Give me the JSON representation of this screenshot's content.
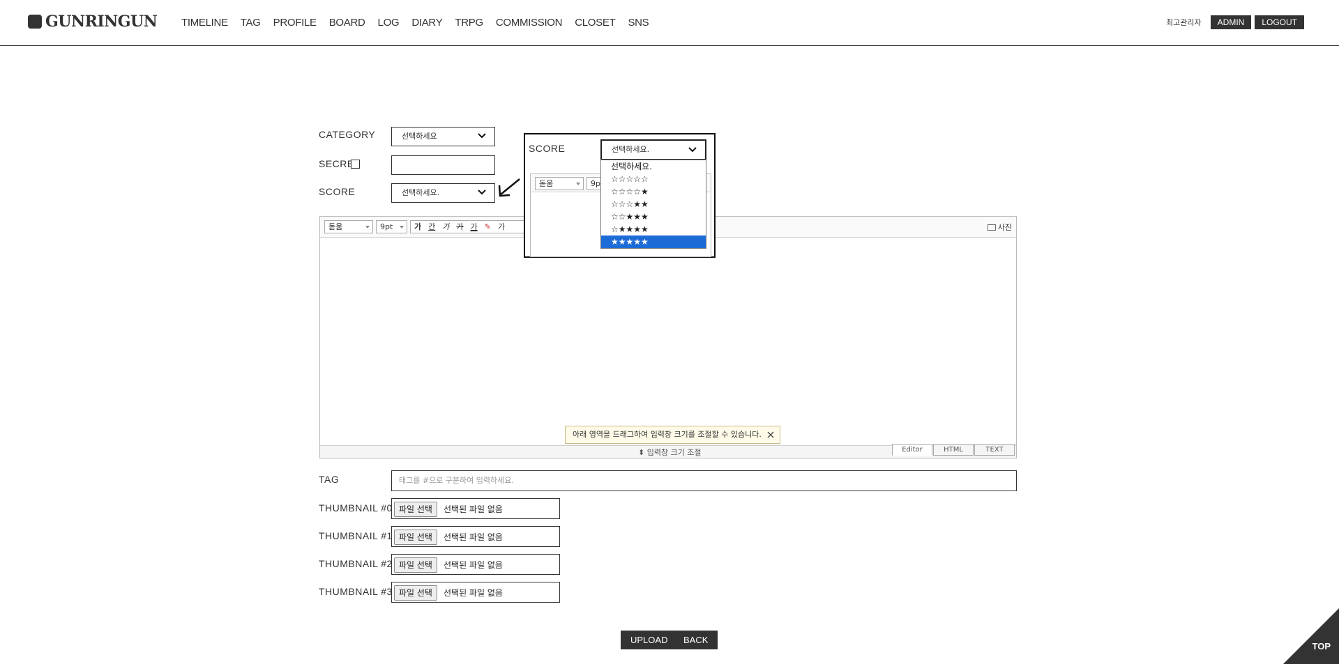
{
  "header": {
    "logo": "GUNRINGUN",
    "nav": [
      "TIMELINE",
      "TAG",
      "PROFILE",
      "BOARD",
      "LOG",
      "DIARY",
      "TRPG",
      "COMMISSION",
      "CLOSET",
      "SNS"
    ],
    "user_name": "최고관리자",
    "admin_label": "ADMIN",
    "logout_label": "LOGOUT"
  },
  "form": {
    "category_label": "CATEGORY",
    "category_value": "선택하세요",
    "secret_label": "SECRET",
    "score_label": "SCORE",
    "score_value": "선택하세요.",
    "tag_label": "TAG",
    "tag_placeholder": "태그를 #으로 구분하여 입력하세요.",
    "thumbnails": [
      {
        "label": "THUMBNAIL #0",
        "button": "파일 선택",
        "status": "선택된 파일 없음"
      },
      {
        "label": "THUMBNAIL #1",
        "button": "파일 선택",
        "status": "선택된 파일 없음"
      },
      {
        "label": "THUMBNAIL #2",
        "button": "파일 선택",
        "status": "선택된 파일 없음"
      },
      {
        "label": "THUMBNAIL #3",
        "button": "파일 선택",
        "status": "선택된 파일 없음"
      }
    ],
    "upload_label": "UPLOAD",
    "back_label": "BACK"
  },
  "editor": {
    "font": "돋움",
    "size": "9pt",
    "bold": "가",
    "underline": "간",
    "italic": "가",
    "strike": "가",
    "color": "가",
    "more": "가",
    "photo": "사진",
    "tooltip": "아래 영역을 드래그하여 입력창 크기를 조절할 수 있습니다.",
    "resize_label": "입력창 크기 조절",
    "tabs": [
      "Editor",
      "HTML",
      "TEXT"
    ]
  },
  "callout": {
    "score_label": "SCORE",
    "select_value": "선택하세요.",
    "font": "돋움",
    "size": "9pt",
    "options": [
      "선택하세요.",
      "☆☆☆☆☆",
      "☆☆☆☆★",
      "☆☆☆★★",
      "☆☆★★★",
      "☆★★★★",
      "★★★★★"
    ],
    "selected_index": 6
  },
  "top_label": "TOP",
  "colors": {
    "dark": "#333333",
    "highlight": "#1c6bd6"
  }
}
